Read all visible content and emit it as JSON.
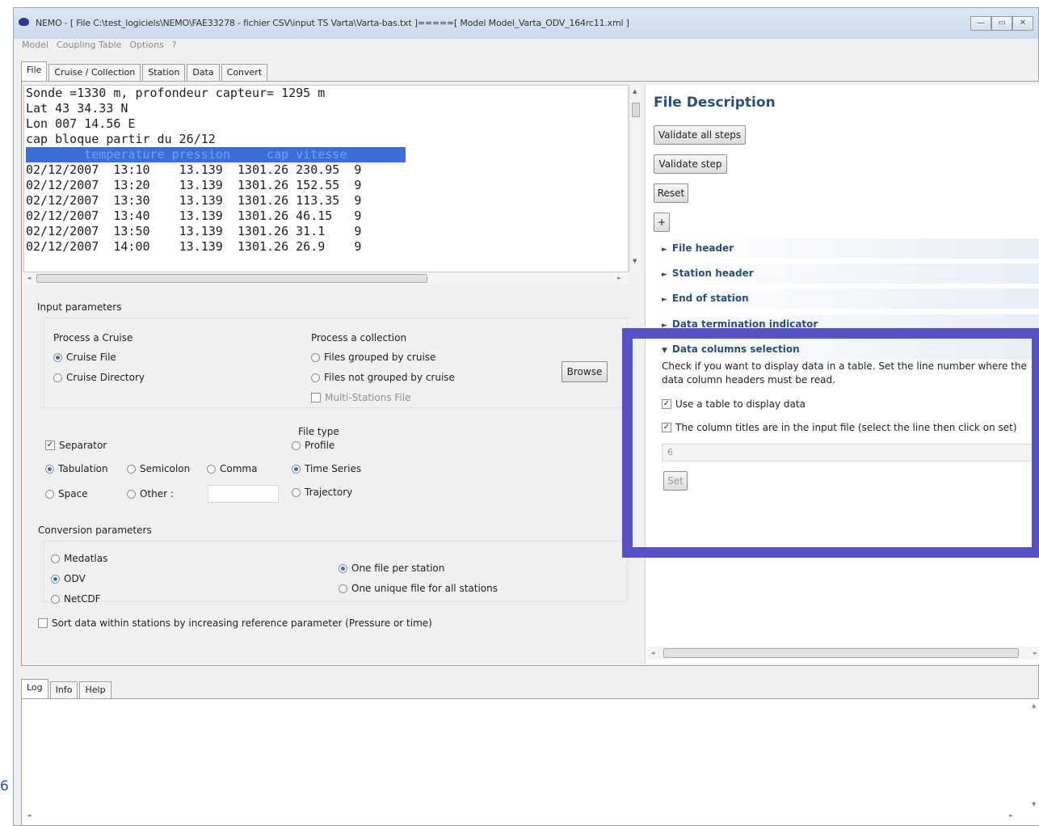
{
  "window": {
    "title": "NEMO - [ File C:\\test_logiciels\\NEMO\\FAE33278 - fichier CSV\\input TS Varta\\Varta-bas.txt ]=====[ Model Model_Varta_ODV_164rc11.xml ]",
    "controls": [
      "—",
      "▭",
      "✕"
    ]
  },
  "menu": [
    "Model",
    "Coupling Table",
    "Options",
    "?"
  ],
  "tabs": [
    "File",
    "Cruise / Collection",
    "Station",
    "Data",
    "Convert"
  ],
  "preview": {
    "lines": [
      "Sonde =1330 m, profondeur capteur= 1295 m",
      "Lat 43 34.33 N",
      "Lon 007 14.56 E",
      "",
      "cap bloque partir du 26/12"
    ],
    "header_line": "        temperature pression     cap vitesse",
    "data_lines": [
      "02/12/2007  13:10    13.139  1301.26 230.95  9",
      "02/12/2007  13:20    13.139  1301.26 152.55  9",
      "02/12/2007  13:30    13.139  1301.26 113.35  9",
      "02/12/2007  13:40    13.139  1301.26 46.15   9",
      "02/12/2007  13:50    13.139  1301.26 31.1    9",
      "02/12/2007  14:00    13.139  1301.26 26.9    9"
    ]
  },
  "input_params": {
    "title": "Input parameters",
    "process_cruise": "Process a Cruise",
    "cruise_file": "Cruise File",
    "cruise_directory": "Cruise Directory",
    "process_collection": "Process a collection",
    "files_grouped": "Files grouped by cruise",
    "files_not_grouped": "Files not grouped by cruise",
    "multi_stations": "Multi-Stations File",
    "browse": "Browse",
    "separator": "Separator",
    "tabulation": "Tabulation",
    "semicolon": "Semicolon",
    "comma": "Comma",
    "space": "Space",
    "other": "Other :",
    "file_type": "File type",
    "profile": "Profile",
    "time_series": "Time Series",
    "trajectory": "Trajectory"
  },
  "conversion_params": {
    "title": "Conversion parameters",
    "medatlas": "Medatlas",
    "odv": "ODV",
    "netcdf": "NetCDF",
    "one_file": "One file per station",
    "one_unique": "One unique file for all stations",
    "sort": "Sort data within stations by increasing reference parameter (Pressure or time)"
  },
  "file_description": {
    "title": "File Description",
    "validate_all": "Validate all steps",
    "validate_step": "Validate step",
    "reset": "Reset",
    "plus": "+",
    "sections": [
      "File header",
      "Station header",
      "End of station",
      "Data termination indicator",
      "Data columns selection"
    ],
    "desc": "Check if you want to display data in a table. Set the line number where the data column headers must be read.",
    "use_table": "Use a table to display data",
    "column_titles": "The column titles are in the input file (select the line then click on set)",
    "line_number": "6",
    "set": "Set"
  },
  "bottom_tabs": [
    "Log",
    "Info",
    "Help"
  ],
  "edge_char": "6",
  "colors": {
    "highlight": "#5552c8",
    "accent": "#2a4f7a",
    "selection": "#3a6fd8"
  }
}
